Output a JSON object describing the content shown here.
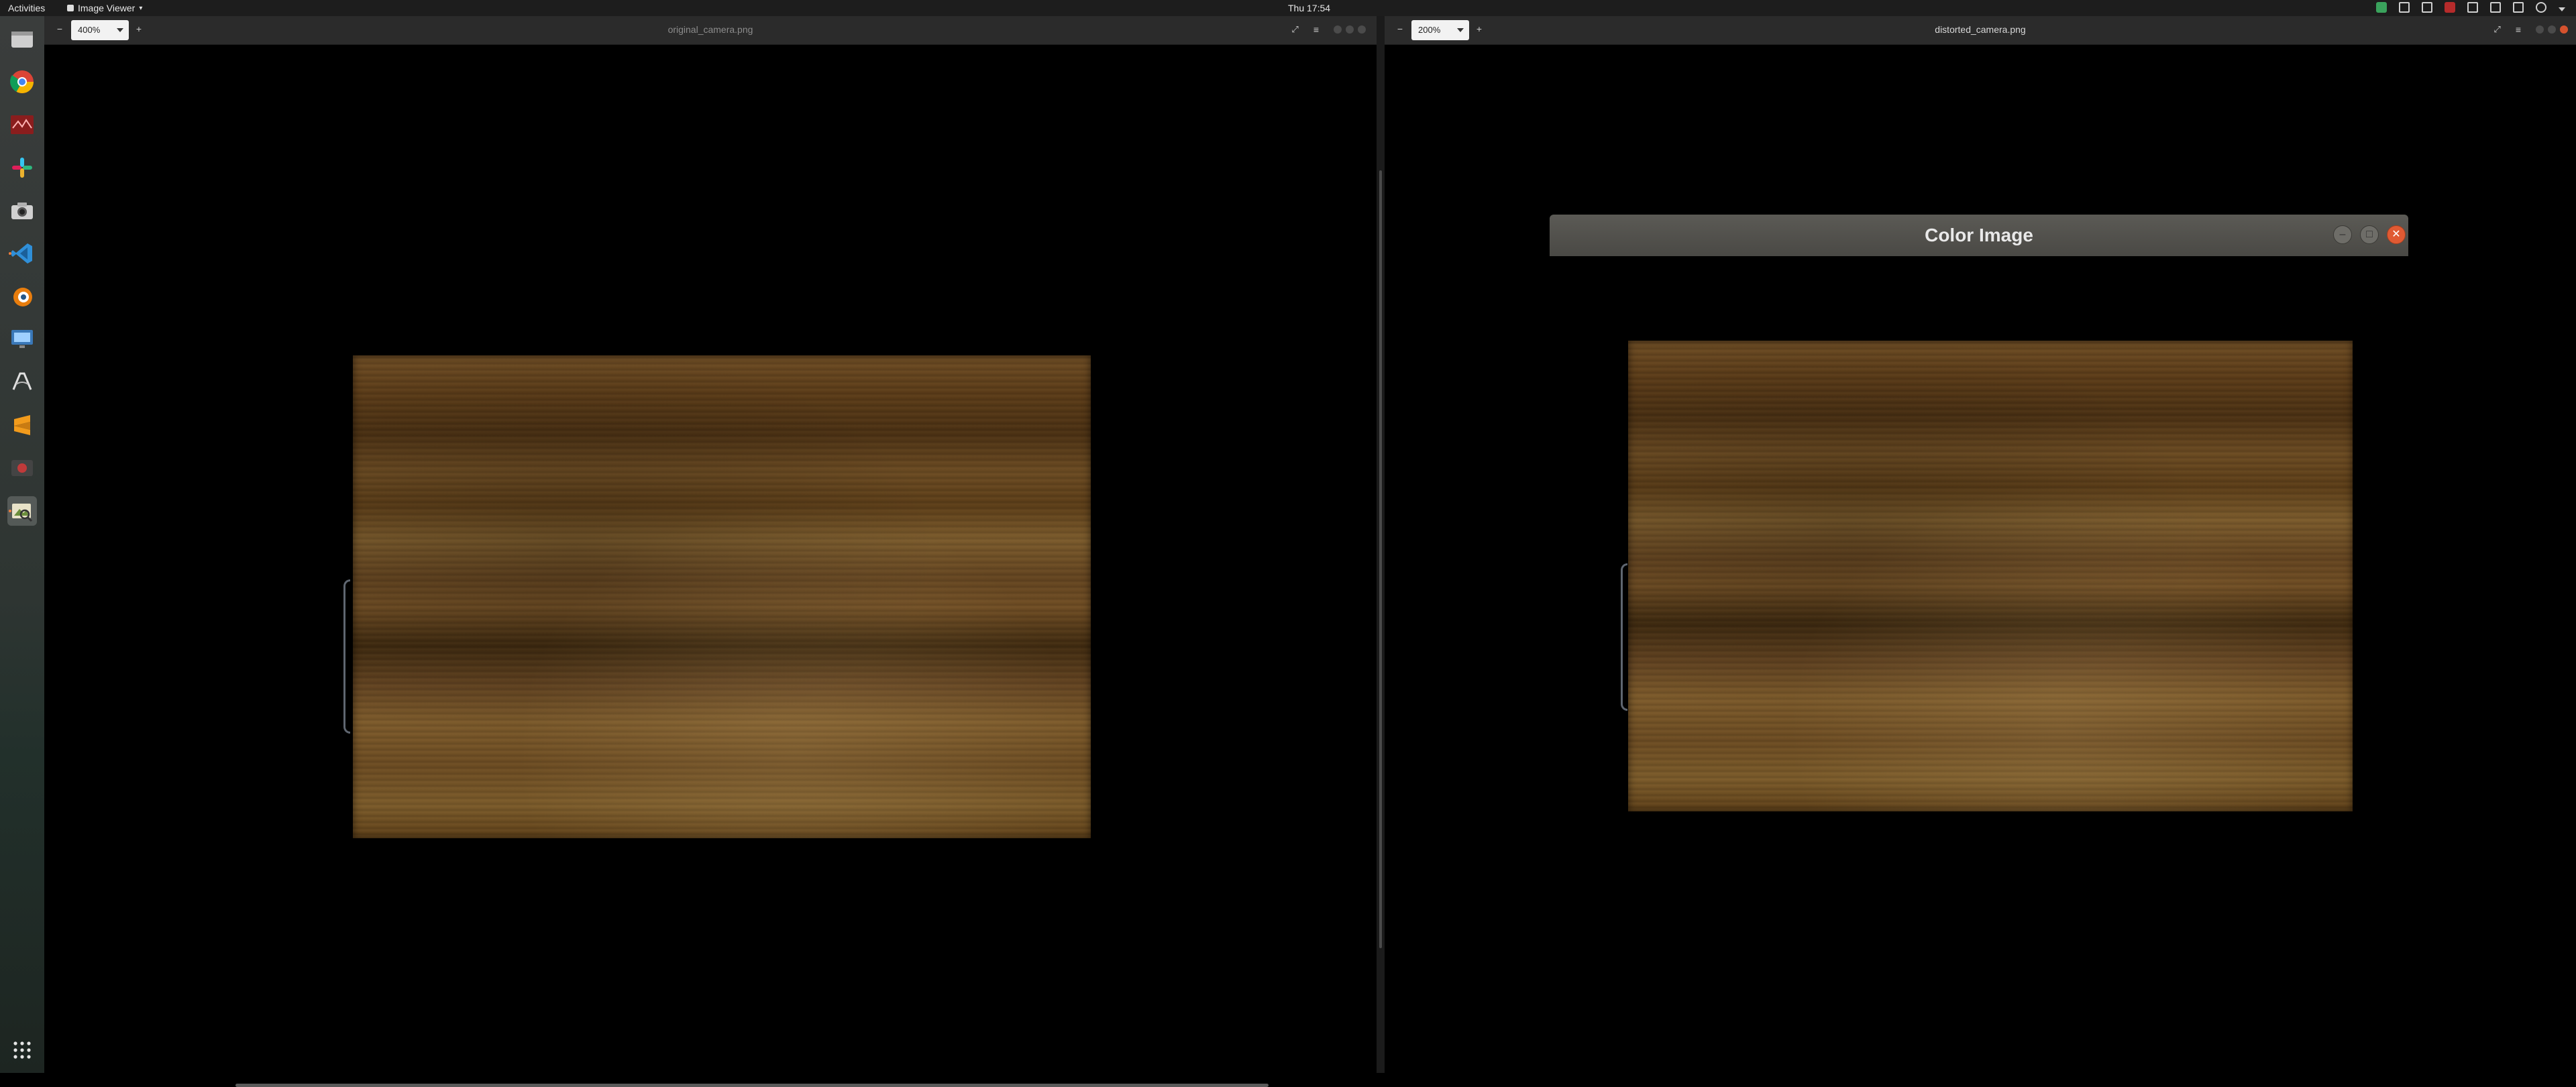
{
  "topbar": {
    "activities": "Activities",
    "app_name": "Image Viewer",
    "clock": "Thu 17:54"
  },
  "dock": {
    "items": [
      {
        "name": "files-icon",
        "color": "#d9d9d9"
      },
      {
        "name": "chrome-icon",
        "color": "#e4a12a"
      },
      {
        "name": "monitor-app-icon",
        "color": "#b8322f"
      },
      {
        "name": "slack-icon",
        "color": "#ffffff"
      },
      {
        "name": "camera-icon",
        "color": "#cfcfcf"
      },
      {
        "name": "vscode-icon",
        "color": "#2f8fd8"
      },
      {
        "name": "blender-icon",
        "color": "#e07b2a"
      },
      {
        "name": "screen-app-icon",
        "color": "#4a86c6"
      },
      {
        "name": "inkscape-icon",
        "color": "#dcdcdc"
      },
      {
        "name": "sublime-icon",
        "color": "#f29b1c"
      },
      {
        "name": "recorder-icon",
        "color": "#c03a3a"
      },
      {
        "name": "image-viewer-icon",
        "color": "#8aa35a"
      }
    ],
    "apps_grid": "show-applications-icon"
  },
  "left_window": {
    "zoom": "400%",
    "title": "original_camera.png"
  },
  "right_window": {
    "zoom": "200%",
    "title": "distorted_camera.png"
  },
  "dialog": {
    "title": "Color Image"
  }
}
